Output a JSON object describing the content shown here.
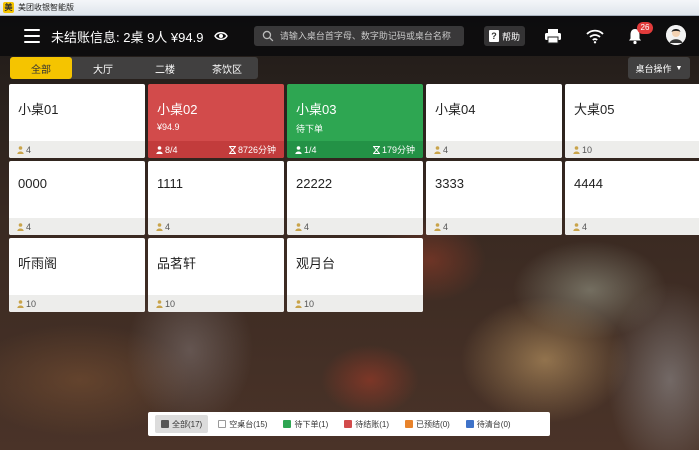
{
  "window": {
    "title": "美团收银智能版"
  },
  "header": {
    "unpaid_info": "未结账信息: 2桌  9人  ¥94.9",
    "search_placeholder": "请输入桌台首字母、数字助记码或桌台名称",
    "help_label": "帮助",
    "notification_count": "26"
  },
  "area_tabs": [
    {
      "label": "全部",
      "active": true
    },
    {
      "label": "大厅",
      "active": false
    },
    {
      "label": "二楼",
      "active": false
    },
    {
      "label": "茶饮区",
      "active": false
    }
  ],
  "table_ops_label": "桌台操作",
  "tables": [
    {
      "name": "小桌01",
      "state": "empty",
      "guests": "4"
    },
    {
      "name": "小桌02",
      "state": "to-settle",
      "amount": "¥94.9",
      "guests": "8/4",
      "duration": "8726分钟"
    },
    {
      "name": "小桌03",
      "state": "to-order",
      "status_text": "待下单",
      "guests": "1/4",
      "duration": "179分钟"
    },
    {
      "name": "小桌04",
      "state": "empty",
      "guests": "4"
    },
    {
      "name": "大桌05",
      "state": "empty",
      "guests": "10"
    },
    {
      "name": "0000",
      "state": "empty",
      "guests": "4"
    },
    {
      "name": "1111",
      "state": "empty",
      "guests": "4"
    },
    {
      "name": "22222",
      "state": "empty",
      "guests": "4"
    },
    {
      "name": "3333",
      "state": "empty",
      "guests": "4"
    },
    {
      "name": "4444",
      "state": "empty",
      "guests": "4"
    },
    {
      "name": "听雨阁",
      "state": "empty",
      "guests": "10"
    },
    {
      "name": "品茗轩",
      "state": "empty",
      "guests": "10"
    },
    {
      "name": "观月台",
      "state": "empty",
      "guests": "10"
    }
  ],
  "legend": [
    {
      "label": "全部(17)",
      "color": "#555555",
      "active": true
    },
    {
      "label": "空桌台(15)",
      "color": "#ffffff",
      "active": false
    },
    {
      "label": "待下单(1)",
      "color": "#2ea652",
      "active": false
    },
    {
      "label": "待结账(1)",
      "color": "#d24b4b",
      "active": false
    },
    {
      "label": "已预结(0)",
      "color": "#e8832b",
      "active": false
    },
    {
      "label": "待清台(0)",
      "color": "#3f73c9",
      "active": false
    }
  ],
  "colors": {
    "accent": "#f5c400",
    "to_settle": "#d24b4b",
    "to_order": "#2ea652"
  }
}
